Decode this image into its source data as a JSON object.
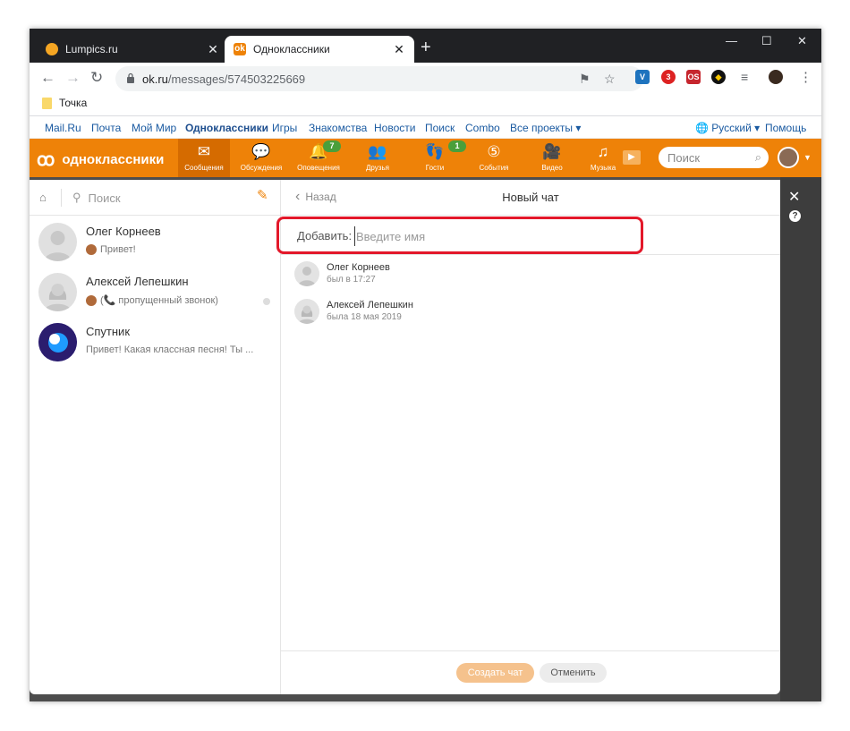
{
  "browser": {
    "tabs": [
      {
        "title": "Lumpics.ru",
        "active": false
      },
      {
        "title": "Одноклассники",
        "active": true
      }
    ],
    "new_tab": "+",
    "url_host": "ok.ru",
    "url_path": "/messages/574503225669",
    "bookmark": "Точка",
    "extension_badge": "3",
    "extension_os": "OS"
  },
  "portal": {
    "links": [
      "Mail.Ru",
      "Почта",
      "Мой Мир",
      "Одноклассники",
      "Игры",
      "Знакомства",
      "Новости",
      "Поиск",
      "Combo",
      "Все проекты"
    ],
    "language": "Русский",
    "help": "Помощь"
  },
  "ok_nav": {
    "logo": "одноклассники",
    "items": [
      {
        "label": "Сообщения",
        "icon": "envelope-icon",
        "active": true
      },
      {
        "label": "Обсуждения",
        "icon": "discussions-icon"
      },
      {
        "label": "Оповещения",
        "icon": "bell-icon",
        "badge": "7"
      },
      {
        "label": "Друзья",
        "icon": "friends-icon"
      },
      {
        "label": "Гости",
        "icon": "footprints-icon",
        "badge": "1"
      },
      {
        "label": "События",
        "icon": "events-icon"
      },
      {
        "label": "Видео",
        "icon": "video-icon"
      },
      {
        "label": "Музыка",
        "icon": "music-icon"
      }
    ],
    "search_placeholder": "Поиск"
  },
  "messages": {
    "search_placeholder": "Поиск",
    "conversations": [
      {
        "name": "Олег Корнеев",
        "preview": "Привет!"
      },
      {
        "name": "Алексей Лепешкин",
        "preview": "(📞 пропущенный звонок)"
      },
      {
        "name": "Спутник",
        "preview": "Привет! Какая классная песня! Ты ..."
      }
    ]
  },
  "new_chat": {
    "back": "Назад",
    "title": "Новый чат",
    "add_label": "Добавить:",
    "add_placeholder": "Введите имя",
    "contacts": [
      {
        "name": "Олег Корнеев",
        "status": "был в 17:27"
      },
      {
        "name": "Алексей Лепешкин",
        "status": "была 18 мая 2019"
      }
    ],
    "create_button": "Создать чат",
    "cancel_button": "Отменить"
  },
  "colors": {
    "ok_orange": "#ee8208",
    "highlight_red": "#e3182a",
    "badge_green": "#4a9f3b"
  }
}
